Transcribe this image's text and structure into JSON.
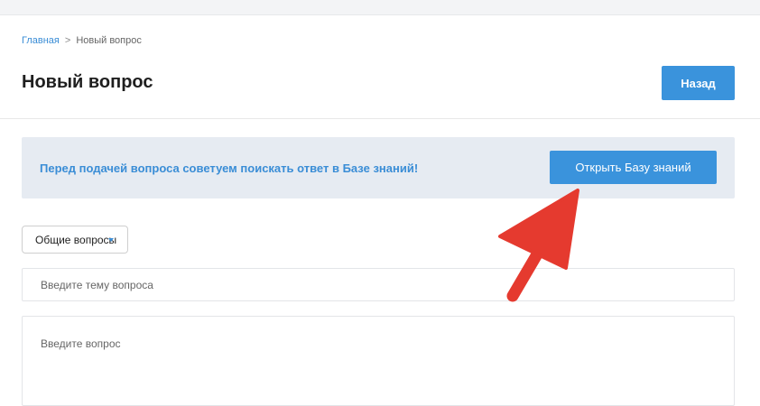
{
  "breadcrumb": {
    "home": "Главная",
    "separator": ">",
    "current": "Новый вопрос"
  },
  "page": {
    "title": "Новый вопрос",
    "back_button": "Назад"
  },
  "banner": {
    "text": "Перед подачей вопроса советуем поискать ответ в Базе знаний!",
    "button": "Открыть Базу знаний"
  },
  "form": {
    "category_selected": "Общие вопросы",
    "subject_placeholder": "Введите тему вопроса",
    "question_placeholder": "Введите вопрос"
  },
  "colors": {
    "accent": "#3a93dc",
    "banner_bg": "#e6ebf2",
    "annotation_arrow": "#e53a2f"
  },
  "icons": {
    "select_caret": "chevron-down-icon",
    "annotation": "red-arrow-icon"
  }
}
